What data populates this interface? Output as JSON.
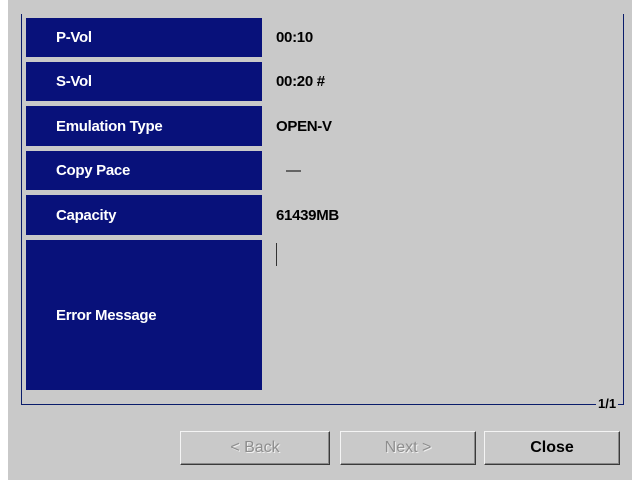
{
  "rows": [
    {
      "label": "P-Vol",
      "value": "00:10"
    },
    {
      "label": "S-Vol",
      "value": "00:20 #"
    },
    {
      "label": "Emulation Type",
      "value": "OPEN-V"
    },
    {
      "label": "Copy Pace",
      "value": "—"
    },
    {
      "label": "Capacity",
      "value": "61439MB"
    },
    {
      "label": "Error Message",
      "value": ""
    }
  ],
  "pagination": {
    "indicator": "1/1"
  },
  "buttons": {
    "back_label": "< Back",
    "next_label": "Next >",
    "close_label": "Close"
  },
  "colors": {
    "label_background": "#08117a",
    "window_background": "#c9c9c9"
  }
}
